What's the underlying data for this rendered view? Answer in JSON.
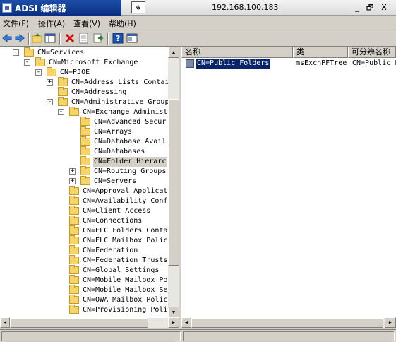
{
  "window": {
    "app_title": "ADSI 编辑器",
    "host_address": "192.168.100.183",
    "controls": [
      "_",
      "🗗",
      "X"
    ]
  },
  "menu": {
    "items": [
      "文件(F)",
      "操作(A)",
      "查看(V)",
      "帮助(H)"
    ]
  },
  "toolbar": {
    "buttons": [
      "back-icon",
      "forward-icon",
      "up-folder-icon",
      "show-tree-icon",
      "delete-icon",
      "properties-icon",
      "export-icon",
      "help-icon",
      "console-tree-icon"
    ]
  },
  "tree": {
    "items": [
      {
        "label": "CN=Services",
        "expander": "-"
      },
      {
        "label": "CN=Microsoft Exchange",
        "expander": "-"
      },
      {
        "label": "CN=PJOE",
        "expander": "-"
      },
      {
        "label": "CN=Address Lists Contai",
        "expander": "+"
      },
      {
        "label": "CN=Addressing",
        "expander": ""
      },
      {
        "label": "CN=Administrative Groups",
        "expander": "-"
      },
      {
        "label": "CN=Exchange Administ",
        "expander": "-"
      },
      {
        "label": "CN=Advanced Secur",
        "expander": ""
      },
      {
        "label": "CN=Arrays",
        "expander": ""
      },
      {
        "label": "CN=Database Avail",
        "expander": ""
      },
      {
        "label": "CN=Databases",
        "expander": ""
      },
      {
        "label": "CN=Folder Hierarc",
        "expander": ""
      },
      {
        "label": "CN=Routing Groups",
        "expander": "+"
      },
      {
        "label": "CN=Servers",
        "expander": "+"
      },
      {
        "label": "CN=Approval Application",
        "expander": ""
      },
      {
        "label": "CN=Availability Configu",
        "expander": ""
      },
      {
        "label": "CN=Client Access",
        "expander": ""
      },
      {
        "label": "CN=Connections",
        "expander": ""
      },
      {
        "label": "CN=ELC Folders Containe",
        "expander": ""
      },
      {
        "label": "CN=ELC Mailbox Policies",
        "expander": ""
      },
      {
        "label": "CN=Federation",
        "expander": ""
      },
      {
        "label": "CN=Federation Trusts",
        "expander": ""
      },
      {
        "label": "CN=Global Settings",
        "expander": ""
      },
      {
        "label": "CN=Mobile Mailbox Polic",
        "expander": ""
      },
      {
        "label": "CN=Mobile Mailbox Setti",
        "expander": ""
      },
      {
        "label": "CN=OWA Mailbox Policies",
        "expander": ""
      },
      {
        "label": "CN=Provisioning Policy C",
        "expander": ""
      }
    ],
    "selected_label": "CN=Folder Hierarc"
  },
  "list": {
    "columns": [
      "名称",
      "类",
      "可分辨名称"
    ],
    "rows": [
      {
        "name": "CN=Public Folders",
        "class": "msExchPFTree",
        "dn": "CN=Public F"
      }
    ]
  }
}
